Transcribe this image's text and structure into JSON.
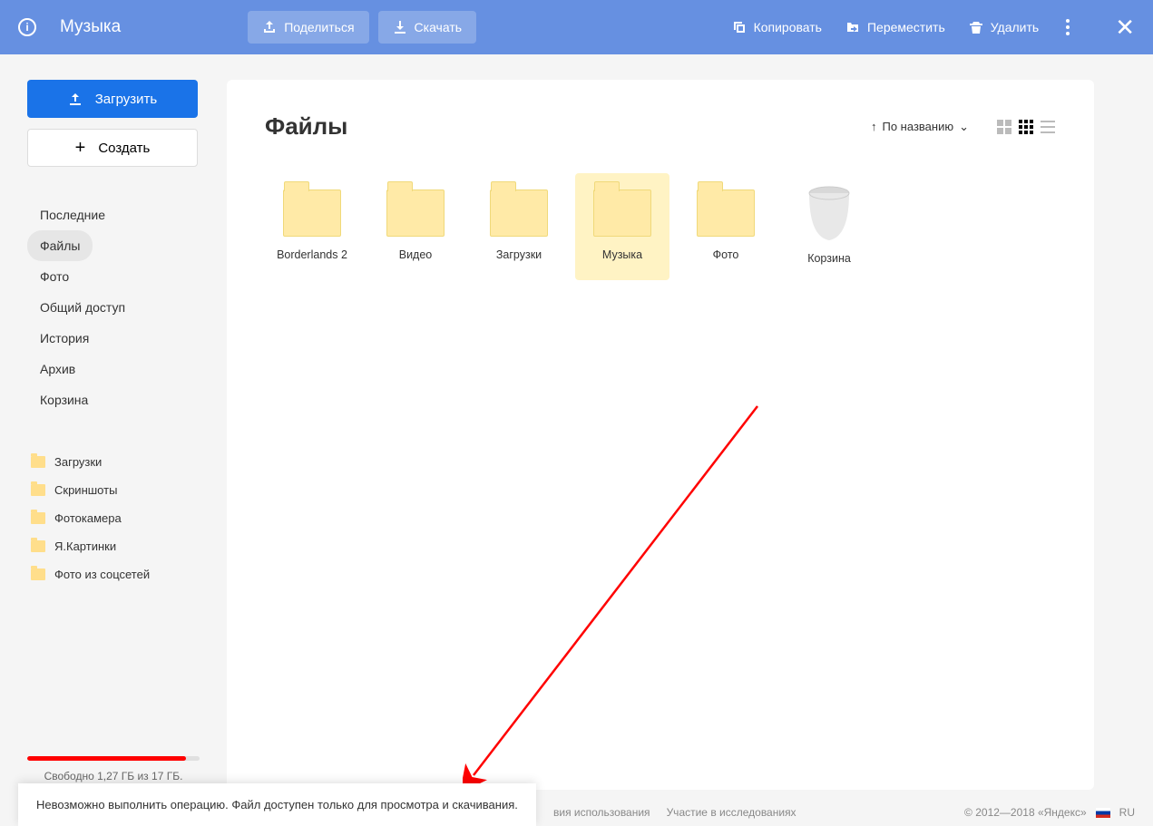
{
  "topbar": {
    "title": "Музыка",
    "share": "Поделиться",
    "download": "Скачать",
    "copy": "Копировать",
    "move": "Переместить",
    "delete": "Удалить"
  },
  "sidebar": {
    "upload": "Загрузить",
    "create": "Создать",
    "nav": [
      "Последние",
      "Файлы",
      "Фото",
      "Общий доступ",
      "История",
      "Архив",
      "Корзина"
    ],
    "nav_active_index": 1,
    "folders": [
      "Загрузки",
      "Скриншоты",
      "Фотокамера",
      "Я.Картинки",
      "Фото из соцсетей"
    ],
    "storage_text": "Свободно 1,27 ГБ из 17 ГБ.",
    "storage_percent": 92
  },
  "main": {
    "title": "Файлы",
    "sort_label": "По названию",
    "items": [
      {
        "name": "Borderlands 2",
        "type": "folder"
      },
      {
        "name": "Видео",
        "type": "folder"
      },
      {
        "name": "Загрузки",
        "type": "folder"
      },
      {
        "name": "Музыка",
        "type": "folder",
        "selected": true
      },
      {
        "name": "Фото",
        "type": "folder"
      },
      {
        "name": "Корзина",
        "type": "trash"
      }
    ]
  },
  "toast": "Невозможно выполнить операцию. Файл доступен только для просмотра и скачивания.",
  "footer": {
    "terms": "вия использования",
    "research": "Участие в исследованиях",
    "copyright": "© 2012—2018 «Яндекс»",
    "lang": "RU"
  }
}
